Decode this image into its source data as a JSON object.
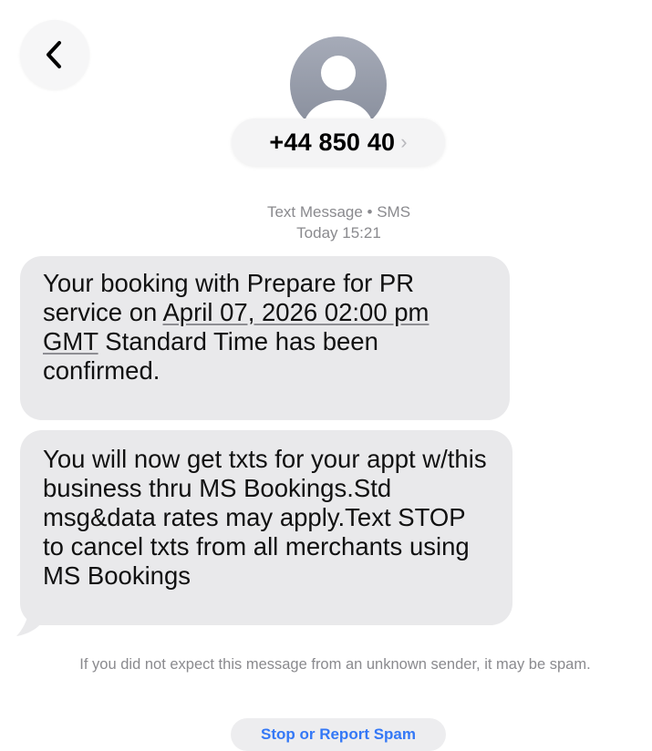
{
  "nav": {
    "back_icon": "chevron-left-icon"
  },
  "contact": {
    "avatar_icon": "person-silhouette-icon",
    "name": "+44 850 40",
    "chevron": "›"
  },
  "meta": {
    "channel": "Text Message • SMS",
    "timestamp": "Today 15:21"
  },
  "messages": [
    {
      "parts": [
        {
          "text": "Your booking with Prepare for PR service on ",
          "link": false
        },
        {
          "text": "April 07, 2026 02:00 pm GMT",
          "link": true
        },
        {
          "text": " Standard Time has been confirmed.",
          "link": false
        }
      ]
    },
    {
      "text": "You will now get txts for your appt w/this business thru MS Bookings.Std msg&data rates may apply.Text STOP to cancel txts from all merchants using MS Bookings"
    }
  ],
  "spam": {
    "notice": "If you did not expect this message from an unknown sender, it may be spam.",
    "button_label": "Stop or Report Spam"
  },
  "colors": {
    "bubble": "#e9e9eb",
    "accent": "#3478f6",
    "secondary_text": "#8a8a8e"
  }
}
